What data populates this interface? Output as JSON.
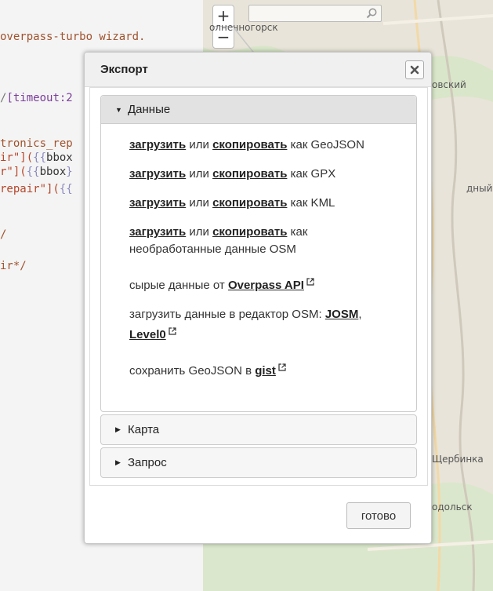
{
  "editor": {
    "lines": [
      {
        "segments": [
          {
            "t": "overpass-turbo wizard.",
            "c": "c-comment"
          }
        ]
      },
      {
        "segments": [
          {
            "t": "/",
            "c": "c-punct"
          },
          {
            "t": "[timeout:2",
            "c": "c-purple"
          }
        ]
      },
      {
        "segments": [
          {
            "t": "tronics_rep",
            "c": "c-comment"
          }
        ]
      },
      {
        "segments": [
          {
            "t": "ir\"](",
            "c": "c-str"
          },
          {
            "t": "{{",
            "c": "c-tmpl"
          },
          {
            "t": "bbox",
            "c": "c-dark"
          }
        ]
      },
      {
        "segments": [
          {
            "t": "r\"](",
            "c": "c-str"
          },
          {
            "t": "{{",
            "c": "c-tmpl"
          },
          {
            "t": "bbox",
            "c": "c-dark"
          },
          {
            "t": "}",
            "c": "c-tmpl"
          }
        ]
      },
      {
        "segments": [
          {
            "t": "repair\"](",
            "c": "c-str"
          },
          {
            "t": "{{",
            "c": "c-tmpl"
          }
        ]
      },
      {
        "segments": [
          {
            "t": "/",
            "c": "c-comment"
          }
        ]
      },
      {
        "segments": [
          {
            "t": "ir*/",
            "c": "c-comment"
          }
        ]
      }
    ]
  },
  "map": {
    "zoom_in": "+",
    "zoom_out": "−",
    "labels": {
      "solnechnogorsk": "олнечногорск",
      "krasnogorsk": "овский",
      "yuzhny": "дный",
      "shcherbinka": "Щербинка",
      "podolsk": "одольск"
    },
    "colors": {
      "marker_stroke": "#4a5fd6",
      "marker_fill": "#e9c870"
    }
  },
  "dialog": {
    "title": "Экспорт",
    "sections": {
      "data": {
        "label": "Данные",
        "rows": {
          "geojson": {
            "download": "загрузить",
            "or": "или",
            "copy": "скопировать",
            "as": "как GeoJSON"
          },
          "gpx": {
            "download": "загрузить",
            "or": "или",
            "copy": "скопировать",
            "as": "как GPX"
          },
          "kml": {
            "download": "загрузить",
            "or": "или",
            "copy": "скопировать",
            "as": "как KML"
          },
          "osm": {
            "download": "загрузить",
            "or": "или",
            "copy": "скопировать",
            "as": "как необработанные данные OSM"
          },
          "raw": {
            "prefix": "сырые данные от",
            "link": "Overpass API"
          },
          "editor": {
            "prefix": "загрузить данные в редактор OSM:",
            "josm": "JOSM",
            "level0": "Level0"
          },
          "gist": {
            "prefix": "сохранить GeoJSON в",
            "link": "gist"
          }
        }
      },
      "map": {
        "label": "Карта"
      },
      "query": {
        "label": "Запрос"
      }
    },
    "done": "готово"
  }
}
